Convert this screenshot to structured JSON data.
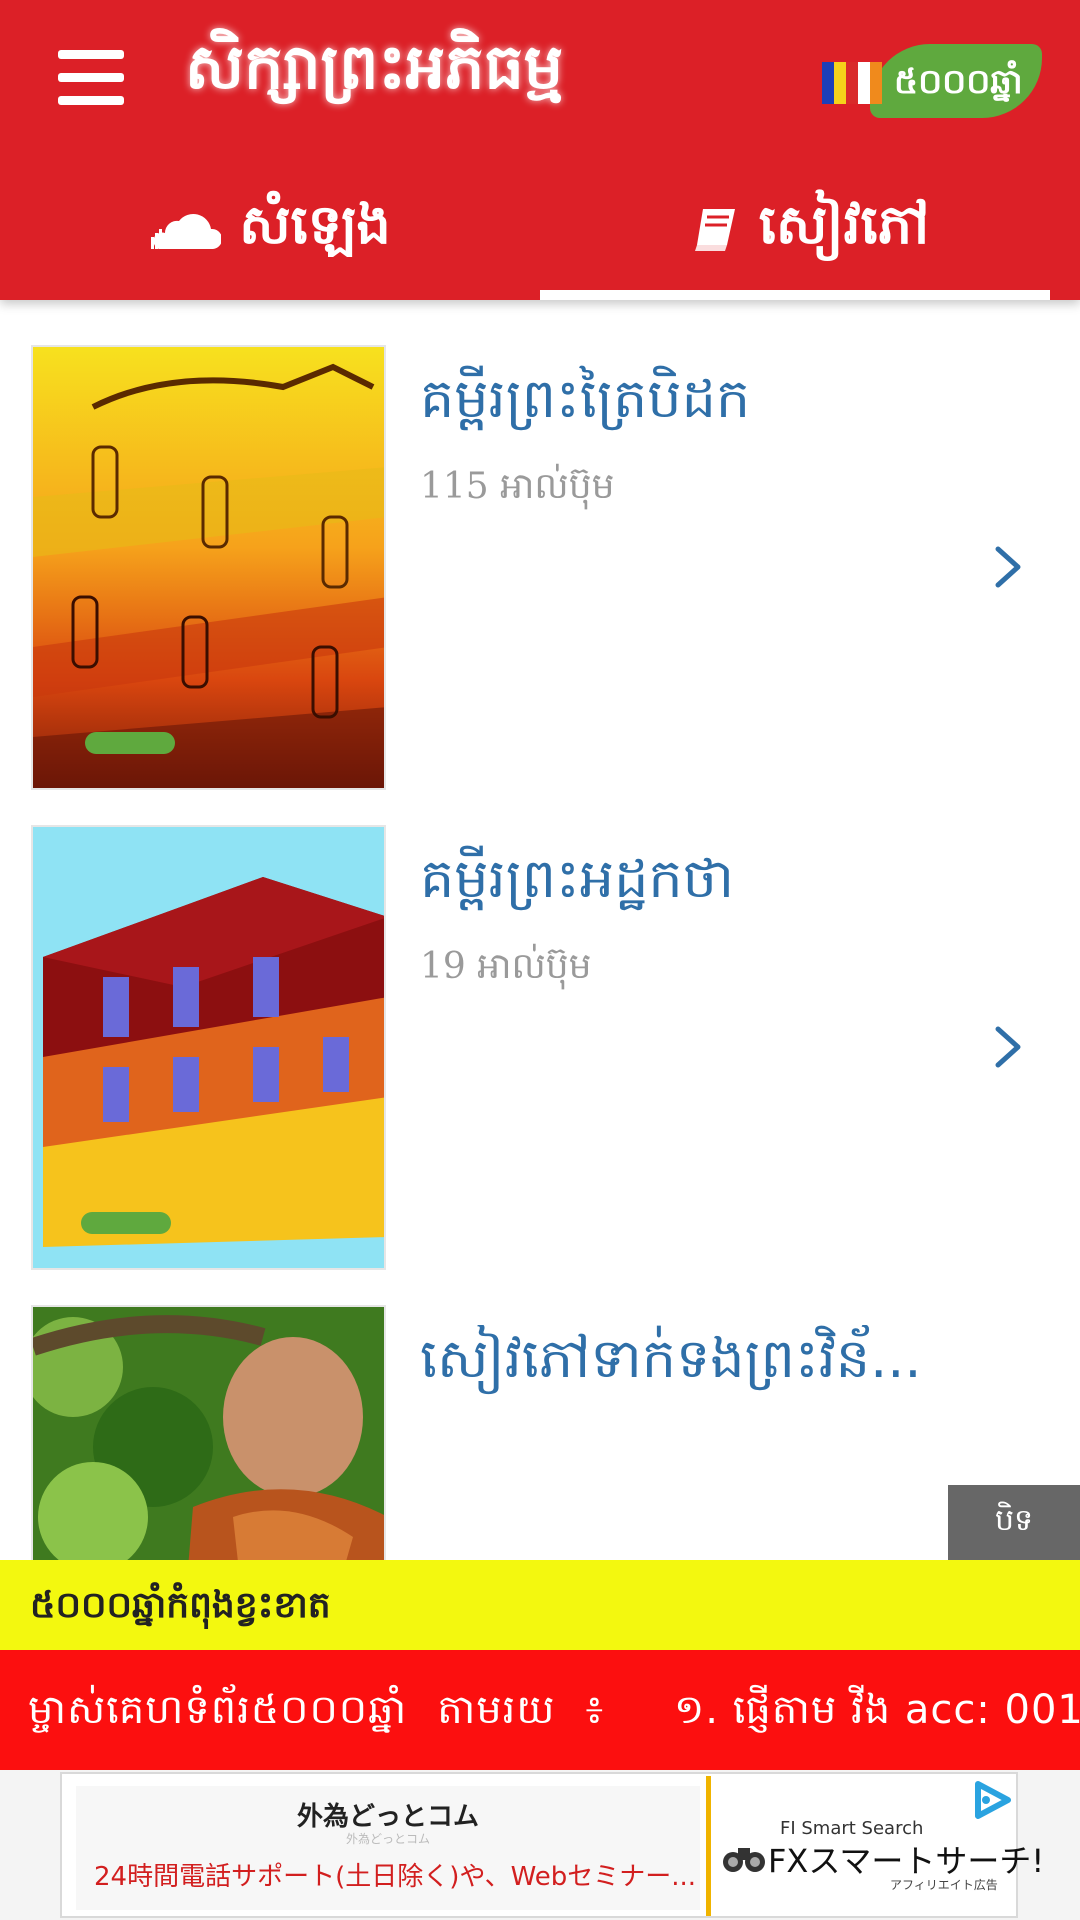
{
  "header": {
    "title": "សិក្សាព្រះអភិធម្ម",
    "logo_text": "៥០០០ឆ្នាំ",
    "colors": {
      "primary": "#dc2027",
      "logo_green": "#5fa93e"
    }
  },
  "tabs": [
    {
      "label": "សំឡេង",
      "icon": "cloud-icon",
      "selected": false
    },
    {
      "label": "សៀវភៅ",
      "icon": "book-icon",
      "selected": true
    }
  ],
  "books": [
    {
      "title": "គម្ពីរព្រះត្រៃបិដក",
      "count": "115 អាល់ប៊ុម",
      "cover": "tipitaka-cover"
    },
    {
      "title": "គម្ពីរព្រះអដ្ឋកថា",
      "count": "19 អាល់ប៊ុម",
      "cover": "atthakatha-cover"
    },
    {
      "title": "សៀវភៅទាក់ទងព្រះវិន័...",
      "count": "",
      "cover": "monk-cover"
    }
  ],
  "close_button": "បិទ",
  "banners": {
    "yellow": "៥០០០ឆ្នាំកំពុងខ្វះខាត",
    "red_part1": "ម្ចាស់គេហទំព័រ៥០០០ឆ្នាំ",
    "red_part2": "តាមរយ",
    "red_part3": "៖",
    "red_part4": "១. ផ្ញើតាម វីង acc: 001",
    "colors": {
      "yellow": "#f3f80f",
      "red": "#fc0f0f"
    }
  },
  "ad": {
    "title": "外為どっとコム",
    "subtitle": "外為どっとコム",
    "description": "24時間電話サポート(土日除く)や、Webセミナー...",
    "logo_small": "FI Smart Search",
    "logo_main": "FXスマートサーチ!",
    "logo_tiny": "アフィリエイト広告"
  }
}
